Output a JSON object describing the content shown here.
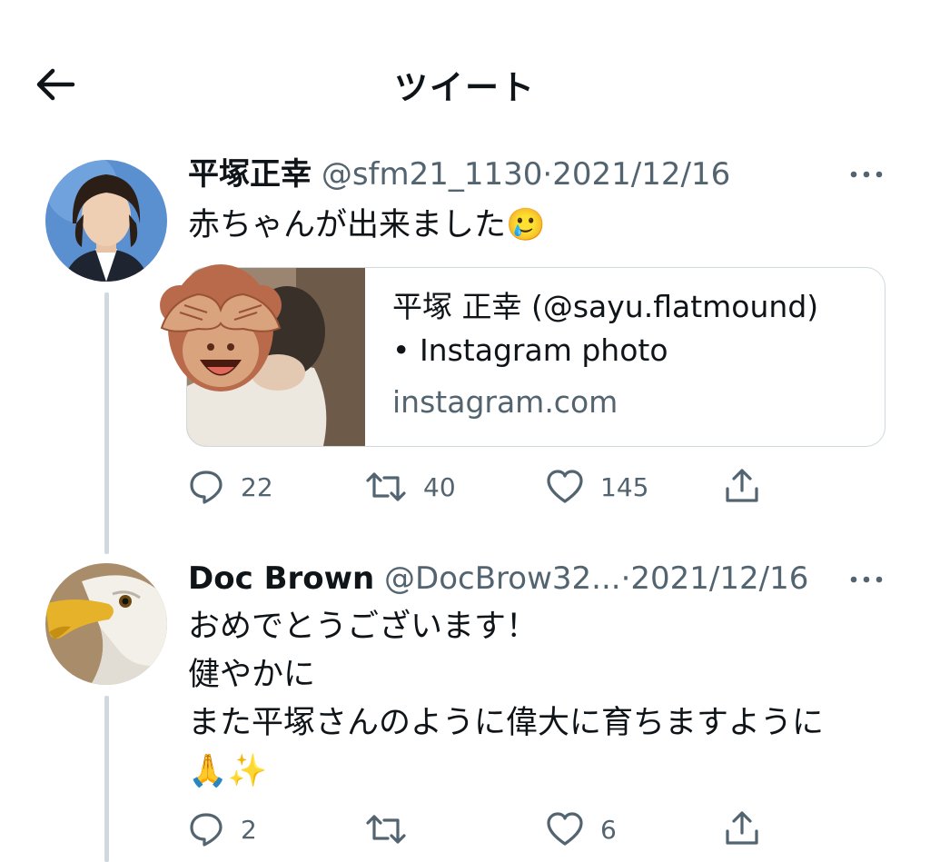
{
  "header": {
    "title": "ツイート",
    "back_icon": "arrow-left-icon"
  },
  "tweets": [
    {
      "name": "平塚正幸",
      "handle": "@sfm21_1130",
      "separator": "·",
      "date": "2021/12/16",
      "text": "赤ちゃんが出来ました",
      "emoji": "🥲",
      "card": {
        "title_line1": "平塚 正幸 (@sayu.flatmound)",
        "title_line2": "• Instagram photo",
        "domain": "instagram.com"
      },
      "stats": {
        "replies": "22",
        "retweets": "40",
        "likes": "145"
      }
    },
    {
      "name": "Doc Brown",
      "handle": "@DocBrow32...",
      "separator": "·",
      "date": "2021/12/16",
      "lines": [
        "おめでとうございます！",
        "健やかに",
        "また平塚さんのように偉大に育ちますように",
        "🙏✨"
      ],
      "stats": {
        "replies": "2",
        "retweets": "",
        "likes": "6"
      }
    }
  ],
  "colors": {
    "text": "#0f1419",
    "secondary": "#536471",
    "border": "#cfd9de"
  }
}
